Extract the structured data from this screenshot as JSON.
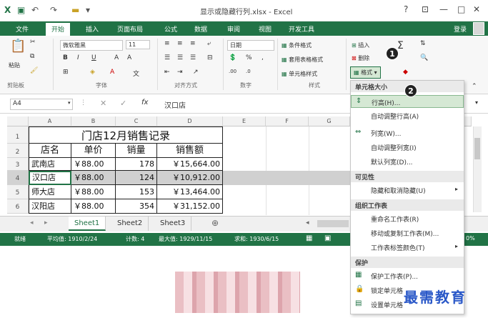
{
  "window": {
    "title": "显示或隐藏行列.xlsx - Excel",
    "buttons": [
      "?",
      "⊡",
      "—",
      "□",
      "✕"
    ]
  },
  "tabs": {
    "file": "文件",
    "items": [
      "开始",
      "插入",
      "页面布局",
      "公式",
      "数据",
      "审阅",
      "视图",
      "开发工具"
    ],
    "active": "开始",
    "login": "登录"
  },
  "ribbon": {
    "paste": "粘贴",
    "font_name": "微软雅黑",
    "font_size": "11",
    "number_format": "日期",
    "conditional_format": "条件格式",
    "table_format": "套用表格格式",
    "cell_style": "单元格样式",
    "insert": "插入",
    "delete": "删除",
    "format": "格式",
    "groups": {
      "clipboard": "剪贴板",
      "font": "字体",
      "alignment": "对齐方式",
      "number": "数字",
      "styles": "样式"
    }
  },
  "formula_bar": {
    "name_box": "A4",
    "value": "汉口店"
  },
  "columns": [
    "A",
    "B",
    "C",
    "D",
    "E",
    "F",
    "G"
  ],
  "sheet": {
    "title": "门店12月销售记录",
    "header": [
      "店名",
      "单价",
      "销量",
      "销售额"
    ],
    "rows": [
      {
        "num": "3",
        "name": "武南店",
        "price": "￥88.00",
        "qty": "178",
        "sales": "￥15,664.00"
      },
      {
        "num": "4",
        "name": "汉口店",
        "price": "￥88.00",
        "qty": "124",
        "sales": "￥10,912.00"
      },
      {
        "num": "5",
        "name": "师大店",
        "price": "￥88.00",
        "qty": "153",
        "sales": "￥13,464.00"
      },
      {
        "num": "6",
        "name": "汉阳店",
        "price": "￥88.00",
        "qty": "354",
        "sales": "￥31,152.00"
      }
    ]
  },
  "sheet_tabs": [
    "Sheet1",
    "Sheet2",
    "Sheet3"
  ],
  "active_sheet": "Sheet1",
  "status": {
    "ready": "就绪",
    "average": "平均值: 1910/2/24",
    "count": "计数: 4",
    "max": "最大值: 1929/11/15",
    "sum": "求和: 1930/6/15",
    "zoom": "0%"
  },
  "menu": {
    "cell_size": "单元格大小",
    "row_height": "行高(H)...",
    "autofit_row": "自动调整行高(A)",
    "col_width": "列宽(W)...",
    "autofit_col": "自动调整列宽(I)",
    "default_width": "默认列宽(D)...",
    "visibility": "可见性",
    "hide_unhide": "隐藏和取消隐藏(U)",
    "organize": "组织工作表",
    "rename": "重命名工作表(R)",
    "move_copy": "移动或复制工作表(M)...",
    "tab_color": "工作表标签颜色(T)",
    "protect": "保护",
    "protect_sheet": "保护工作表(P)...",
    "lock_cell": "锁定单元格",
    "format_cells": "设置单元格"
  },
  "badges": [
    "1",
    "2"
  ],
  "watermark": "最需教育",
  "colors": {
    "excel_green": "#217346",
    "highlight": "#d5e8d4"
  }
}
